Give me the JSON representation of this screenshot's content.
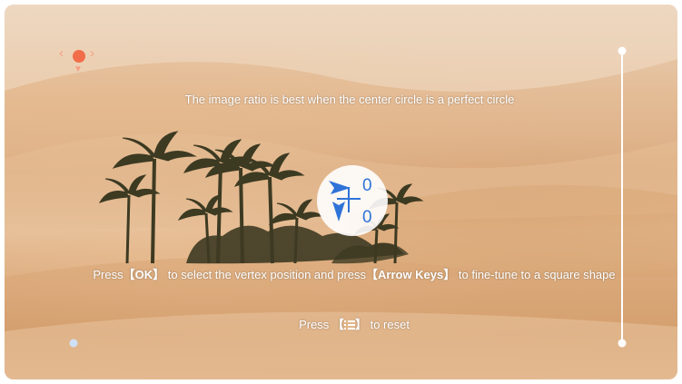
{
  "guidance": {
    "top_hint": "The image ratio is best when the center circle is a perfect circle",
    "select_hint_prefix": "Press",
    "ok_key": "【OK】",
    "select_hint_mid": "to select the vertex position and press",
    "arrow_keys": "【Arrow Keys】",
    "select_hint_suffix": "to fine-tune to a square shape",
    "reset_hint_prefix": "Press",
    "menu_key_open": "【",
    "menu_key_close": "】",
    "reset_hint_suffix": "to reset"
  },
  "center_indicator": {
    "horizontal_offset": "0",
    "vertical_offset": "0"
  },
  "icons": {
    "vertex_handle": "selected-vertex-handle-icon",
    "menu": "menu-list-icon",
    "offset": "crosshair-offset-icon"
  },
  "colors": {
    "active_edge": "#2f73d8",
    "frame_edge": "#ffffff",
    "selected_vertex": "#f26d4a",
    "hint_text": "#ffffff"
  }
}
